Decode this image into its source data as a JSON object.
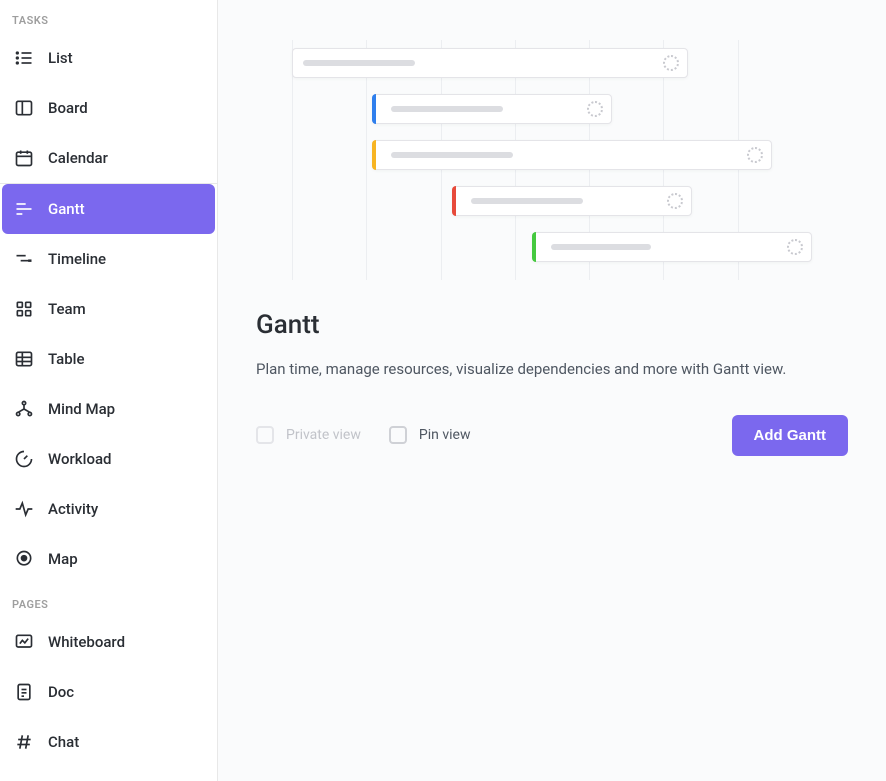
{
  "sidebar": {
    "sections": [
      {
        "header": "TASKS",
        "items": [
          {
            "id": "list",
            "label": "List",
            "active": false
          },
          {
            "id": "board",
            "label": "Board",
            "active": false
          },
          {
            "id": "calendar",
            "label": "Calendar",
            "active": false
          },
          {
            "id": "gantt",
            "label": "Gantt",
            "active": true
          },
          {
            "id": "timeline",
            "label": "Timeline",
            "active": false
          },
          {
            "id": "team",
            "label": "Team",
            "active": false
          },
          {
            "id": "table",
            "label": "Table",
            "active": false
          },
          {
            "id": "mindmap",
            "label": "Mind Map",
            "active": false
          },
          {
            "id": "workload",
            "label": "Workload",
            "active": false
          },
          {
            "id": "activity",
            "label": "Activity",
            "active": false
          },
          {
            "id": "map",
            "label": "Map",
            "active": false
          }
        ]
      },
      {
        "header": "PAGES",
        "items": [
          {
            "id": "whiteboard",
            "label": "Whiteboard",
            "active": false
          },
          {
            "id": "doc",
            "label": "Doc",
            "active": false
          },
          {
            "id": "chat",
            "label": "Chat",
            "active": false
          }
        ]
      }
    ]
  },
  "main": {
    "title": "Gantt",
    "description": "Plan time, manage resources, visualize dependencies and more with Gantt view.",
    "privateView": {
      "label": "Private view",
      "checked": false,
      "disabled": true
    },
    "pinView": {
      "label": "Pin view",
      "checked": false,
      "disabled": false
    },
    "addButton": "Add Gantt"
  },
  "colors": {
    "accent": "#7b68ee"
  }
}
